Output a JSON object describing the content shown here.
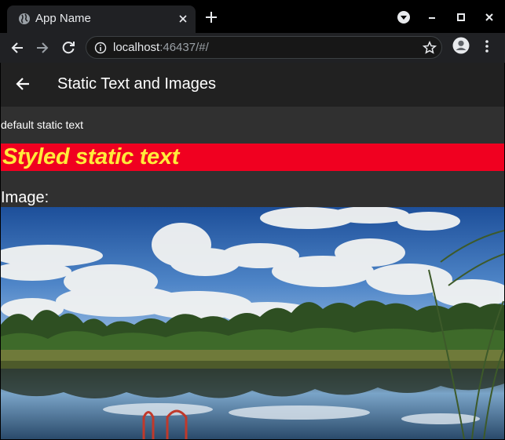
{
  "browser": {
    "tab_title": "App Name",
    "url_host": "localhost",
    "url_rest": ":46437/#/"
  },
  "app": {
    "appbar_title": "Static Text and Images",
    "default_text": "default static text",
    "styled_text": "Styled static text",
    "image_label": "Image:"
  },
  "colors": {
    "styled_band": "#f00020",
    "styled_text": "#ffeb3b",
    "appbar": "#212121",
    "page_bg": "#303030"
  },
  "icons": [
    "globe-icon",
    "close-icon",
    "plus-icon",
    "minimize-icon",
    "maximize-icon",
    "window-close-icon",
    "back-icon",
    "forward-icon",
    "reload-icon",
    "info-icon",
    "star-icon",
    "profile-icon",
    "kebab-menu-icon",
    "arrow-back-icon"
  ]
}
